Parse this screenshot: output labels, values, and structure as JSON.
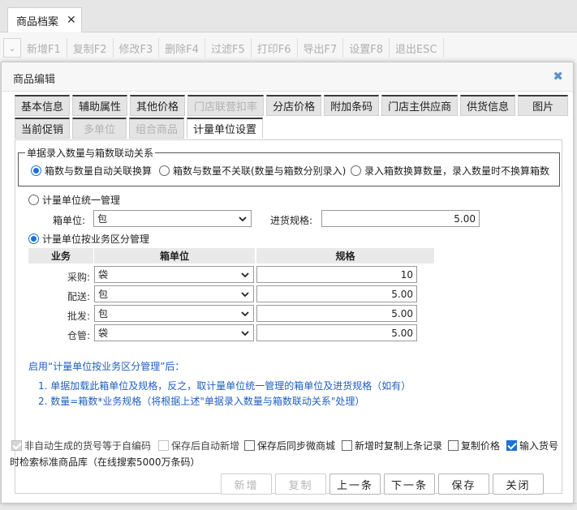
{
  "app": {
    "tab_label": "商品档案",
    "toolbar": [
      "新增F1",
      "复制F2",
      "修改F3",
      "删除F4",
      "过滤F5",
      "打印F6",
      "导出F7",
      "设置F8",
      "退出ESC"
    ]
  },
  "dialog": {
    "title": "商品编辑",
    "tabs_row1": [
      {
        "label": "基本信息",
        "state": "normal"
      },
      {
        "label": "辅助属性",
        "state": "normal"
      },
      {
        "label": "其他价格",
        "state": "normal"
      },
      {
        "label": "门店联营扣率",
        "state": "disabled"
      },
      {
        "label": "分店价格",
        "state": "normal"
      },
      {
        "label": "附加条码",
        "state": "normal"
      },
      {
        "label": "门店主供应商",
        "state": "normal"
      },
      {
        "label": "供货信息",
        "state": "normal"
      },
      {
        "label": "图片",
        "state": "normal"
      }
    ],
    "tabs_row2": [
      {
        "label": "当前促销",
        "state": "normal"
      },
      {
        "label": "多单位",
        "state": "disabled"
      },
      {
        "label": "组合商品",
        "state": "disabled"
      },
      {
        "label": "计量单位设置",
        "state": "active"
      }
    ],
    "linkage": {
      "legend": "单据录入数量与箱数联动关系",
      "options": [
        {
          "label": "箱数与数量自动关联换算",
          "checked": true
        },
        {
          "label": "箱数与数量不关联(数量与箱数分别录入)",
          "checked": false
        },
        {
          "label": "录入箱数换算数量，录入数量时不换算箱数",
          "checked": false
        }
      ]
    },
    "unified": {
      "radio_label": "计量单位统一管理",
      "checked": false,
      "box_unit_label": "箱单位:",
      "box_unit_value": "包",
      "purchase_spec_label": "进货规格:",
      "purchase_spec_value": "5.00"
    },
    "by_business": {
      "radio_label": "计量单位按业务区分管理",
      "checked": true,
      "headers": {
        "business": "业务",
        "unit": "箱单位",
        "spec": "规格"
      },
      "rows": [
        {
          "label": "采购:",
          "unit": "袋",
          "spec": "10"
        },
        {
          "label": "配送:",
          "unit": "包",
          "spec": "5.00"
        },
        {
          "label": "批发:",
          "unit": "包",
          "spec": "5.00"
        },
        {
          "label": "仓管:",
          "unit": "袋",
          "spec": "5.00"
        }
      ]
    },
    "notes": {
      "intro": "启用“计量单位按业务区分管理”后：",
      "line1": "1. 单据加载此箱单位及规格，反之，取计量单位统一管理的箱单位及进货规格（如有）",
      "line2": "2. 数量=箱数*业务规格（将根据上述\"单据录入数量与箱数联动关系\"处理）"
    },
    "options": [
      {
        "label": "非自动生成的货号等于自编码",
        "checked": true,
        "disabled": true
      },
      {
        "label": "保存后自动新增",
        "checked": false,
        "disabled": true
      },
      {
        "label": "保存后同步微商城",
        "checked": false,
        "disabled": false
      },
      {
        "label": "新增时复制上条记录",
        "checked": false,
        "disabled": false
      },
      {
        "label": "复制价格",
        "checked": false,
        "disabled": false
      },
      {
        "label": "输入货号",
        "checked": true,
        "disabled": false
      }
    ],
    "options_tail": "时检索标准商品库（在线搜索5000万条码）",
    "buttons": [
      {
        "label": "新增",
        "enabled": false
      },
      {
        "label": "复制",
        "enabled": false
      },
      {
        "label": "上一条",
        "enabled": true
      },
      {
        "label": "下一条",
        "enabled": true
      },
      {
        "label": "保存",
        "enabled": true
      },
      {
        "label": "关闭",
        "enabled": true
      }
    ]
  },
  "colors": {
    "accent": "#1f6fd8",
    "note_text": "#1f5fbf",
    "close_icon": "#5b8fd0"
  }
}
